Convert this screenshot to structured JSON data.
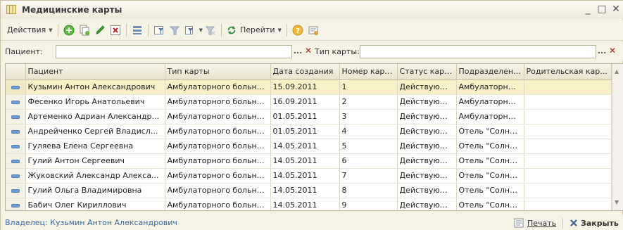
{
  "window": {
    "title": "Медицинские карты",
    "minimize": "_",
    "maximize": "□",
    "close": "✕"
  },
  "toolbar": {
    "actions_label": "Действия",
    "goto_label": "Перейти",
    "icons": [
      "add-icon",
      "copy-icon",
      "edit-icon",
      "delete-icon",
      "hierarchy-icon",
      "filter-icon",
      "filter-off-icon",
      "filter-menu-icon",
      "filter-clear-icon",
      "refresh-icon",
      "help-icon",
      "info-icon"
    ]
  },
  "filters": {
    "patient_label": "Пациент:",
    "patient_value": "",
    "card_type_label": "Тип карты:",
    "card_type_value": "",
    "select_btn": "...",
    "clear_btn": "✕"
  },
  "table": {
    "columns": [
      "Пациент",
      "Тип карты",
      "Дата создания",
      "Номер карты",
      "Статус карты",
      "Подразделение",
      "Родительская кар..."
    ],
    "rows": [
      [
        "Кузьмин  Антон Александрович",
        "Амбулаторного больного",
        "15.09.2011",
        "1",
        "Действующая",
        "Амбулаторны...",
        ""
      ],
      [
        "Фесенко Игорь Анатольевич",
        "Амбулаторного больного",
        "16.09.2011",
        "2",
        "Действующая",
        "Амбулаторны...",
        ""
      ],
      [
        "Артеменко Адриан Александр...",
        "Амбулаторного больного",
        "01.05.2011",
        "3",
        "Действующая",
        "Амбулаторны...",
        ""
      ],
      [
        "Андрейченко Сергей Владисл...",
        "Амбулаторного больного",
        "01.05.2011",
        "4",
        "Действующая",
        "Отель \"Солне...",
        ""
      ],
      [
        "Гуляева Елена Сергеевна",
        "Амбулаторного больного",
        "14.05.2011",
        "5",
        "Действующая",
        "Отель \"Солне...",
        ""
      ],
      [
        "Гулий Антон  Сергеевич",
        "Амбулаторного больного",
        "14.05.2011",
        "6",
        "Действующая",
        "Отель \"Солне...",
        ""
      ],
      [
        "Жуковский Александр Алекса...",
        "Амбулаторного больного",
        "14.05.2011",
        "7",
        "Действующая",
        "Отель \"Солне...",
        ""
      ],
      [
        "Гулий Ольга Владимировна",
        "Амбулаторного больного",
        "14.05.2011",
        "8",
        "Действующая",
        "Отель \"Солне...",
        ""
      ],
      [
        "Бабич Олег Кириллович",
        "Амбулаторного больного",
        "14.05.2011",
        "9",
        "Действующая",
        "Отель \"Солне...",
        ""
      ]
    ],
    "selected_row": 0
  },
  "status": {
    "owner": "Владелец: Кузьмин  Антон Александрович",
    "print_label": "Печать",
    "close_label": "Закрыть"
  }
}
